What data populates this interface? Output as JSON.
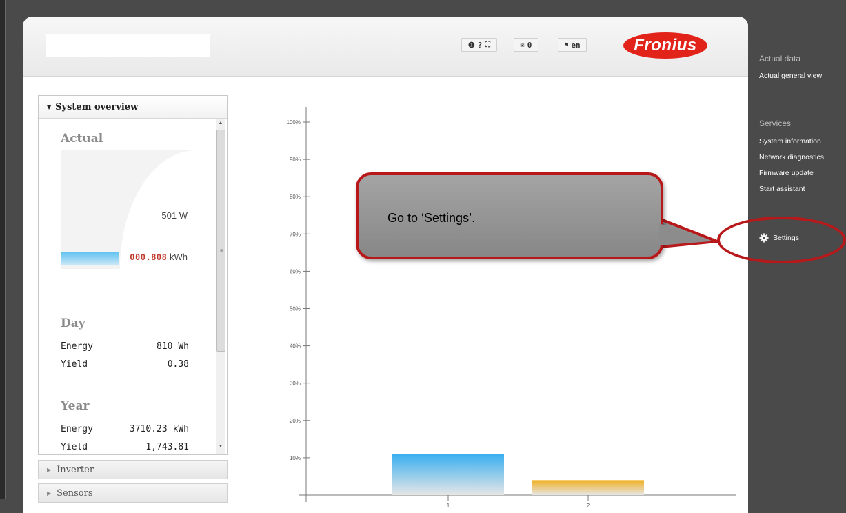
{
  "header": {
    "buttons": [
      {
        "id": "info",
        "label": "❶"
      },
      {
        "id": "help",
        "label": "?"
      },
      {
        "id": "fullscreen",
        "label": "⛶"
      },
      {
        "id": "messages",
        "label": "0"
      },
      {
        "id": "language",
        "label": "en"
      }
    ],
    "logo_text": "Fronius"
  },
  "overview": {
    "title": "System overview",
    "actual": {
      "heading": "Actual",
      "power": "501 W",
      "energy_digits": "000.808",
      "energy_unit": "kWh"
    },
    "day": {
      "heading": "Day",
      "rows": [
        {
          "label": "Energy",
          "value": "810 Wh"
        },
        {
          "label": "Yield",
          "value": "0.38"
        }
      ]
    },
    "year": {
      "heading": "Year",
      "rows": [
        {
          "label": "Energy",
          "value": "3710.23 kWh"
        },
        {
          "label": "Yield",
          "value": "1,743.81"
        }
      ]
    },
    "accordion": [
      "Inverter",
      "Sensors"
    ]
  },
  "chart_data": {
    "type": "bar",
    "categories": [
      "1",
      "2"
    ],
    "values": [
      11,
      4
    ],
    "colors": [
      "#3aaff0",
      "#f0b020"
    ],
    "y_ticks": [
      "10%",
      "20%",
      "30%",
      "40%",
      "50%",
      "60%",
      "70%",
      "80%",
      "90%",
      "100%"
    ],
    "ylim": [
      0,
      100
    ],
    "grid": false
  },
  "sidebar": {
    "actual_heading": "Actual data",
    "actual_items": [
      "Actual general view"
    ],
    "services_heading": "Services",
    "services_items": [
      "System information",
      "Network diagnostics",
      "Firmware update",
      "Start assistant"
    ],
    "settings_label": "Settings"
  },
  "callout": {
    "text": "Go to ‘Settings’."
  },
  "colors": {
    "accent_red": "#b8181a",
    "logo_red": "#e2231a",
    "sidebar_bg": "#4a4a4a"
  }
}
